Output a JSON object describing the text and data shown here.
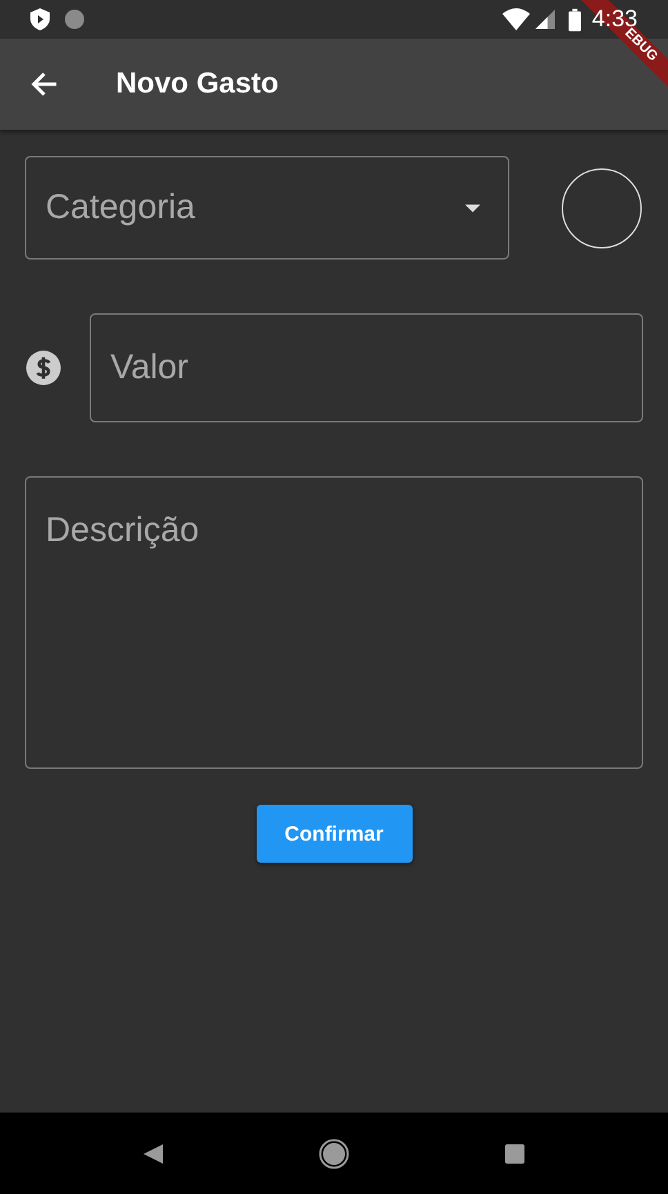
{
  "status_bar": {
    "time": "4:33"
  },
  "debug_banner": {
    "text": "EBUG"
  },
  "app_bar": {
    "title": "Novo Gasto"
  },
  "form": {
    "category": {
      "placeholder": "Categoria"
    },
    "value": {
      "placeholder": "Valor"
    },
    "description": {
      "placeholder": "Descrição"
    },
    "confirm_button": "Confirmar"
  }
}
